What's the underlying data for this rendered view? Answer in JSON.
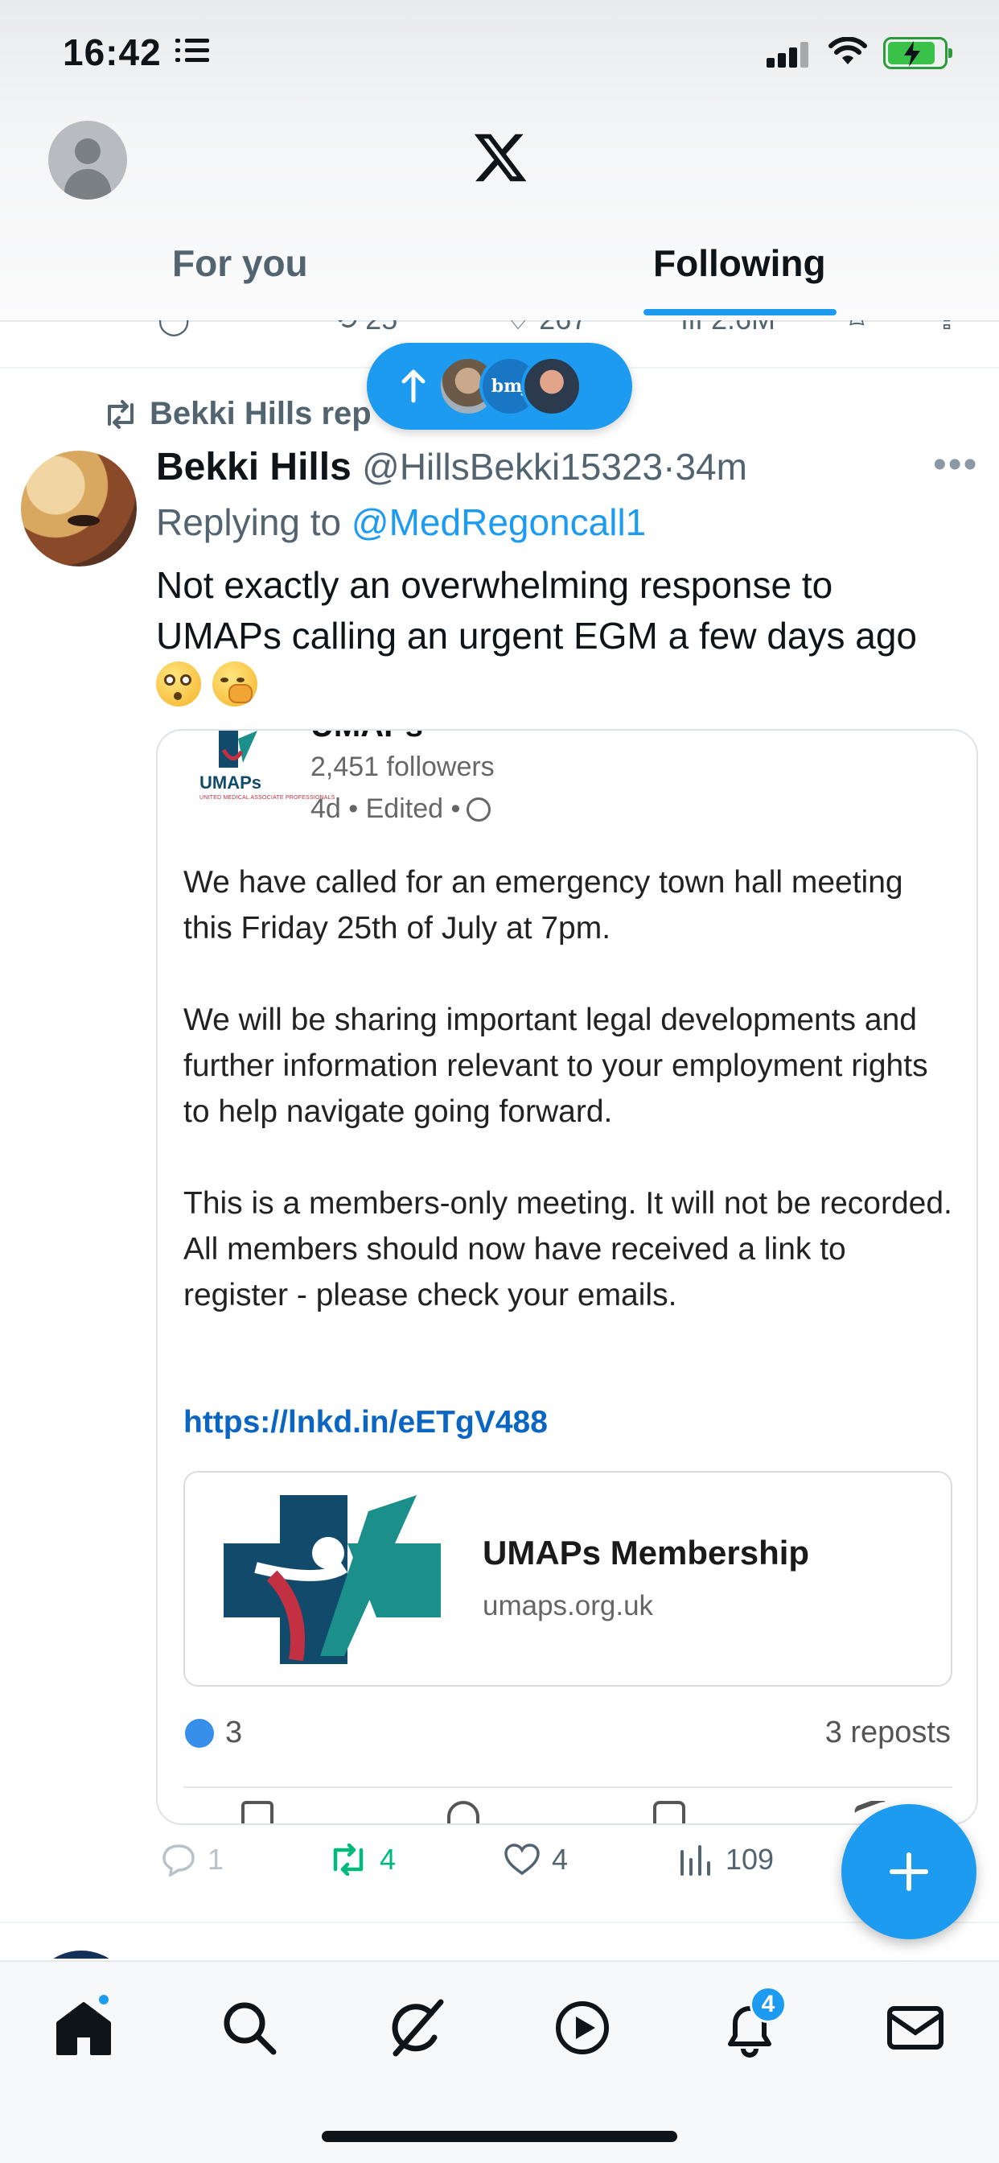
{
  "status_bar": {
    "time": "16:42"
  },
  "header": {
    "tabs": [
      {
        "label": "For you",
        "active": false
      },
      {
        "label": "Following",
        "active": true
      }
    ]
  },
  "tweet": {
    "retweet_label": "Bekki Hills rep",
    "author_name": "Bekki Hills",
    "author_handle": "@HillsBekki15323",
    "time_ago": "34m",
    "separator": "·",
    "replying_prefix": "Replying to ",
    "replying_to": "@MedRegoncall1",
    "text": "Not exactly an overwhelming response to UMAPs calling an urgent EGM a few days ago",
    "actions": {
      "reply": "1",
      "reposts": "4",
      "likes": "4",
      "views": "109"
    }
  },
  "embed": {
    "org_logo_text": "UMAPs",
    "followers": "2,451 followers",
    "posted": "4d • Edited •",
    "paragraphs": [
      "We have called for an emergency town hall meeting this Friday 25th of July at 7pm.",
      "We will be sharing important legal developments and further information relevant to your employment rights to help navigate going forward.",
      "This is a members-only meeting. It will not be recorded. All members should now have received a link to register - please check your emails."
    ],
    "link": "https://lnkd.in/eETgV488",
    "preview_title": "UMAPs Membership",
    "preview_domain": "umaps.org.uk",
    "reactions_count": "3",
    "reposts": "3 reposts"
  },
  "bottom_nav": {
    "notification_count": "4"
  },
  "colors": {
    "accent": "#1d9bf0",
    "repost_green": "#00ba7c",
    "text": "#0f1419",
    "muted": "#536471",
    "linkedin_link": "#0a66c2"
  }
}
